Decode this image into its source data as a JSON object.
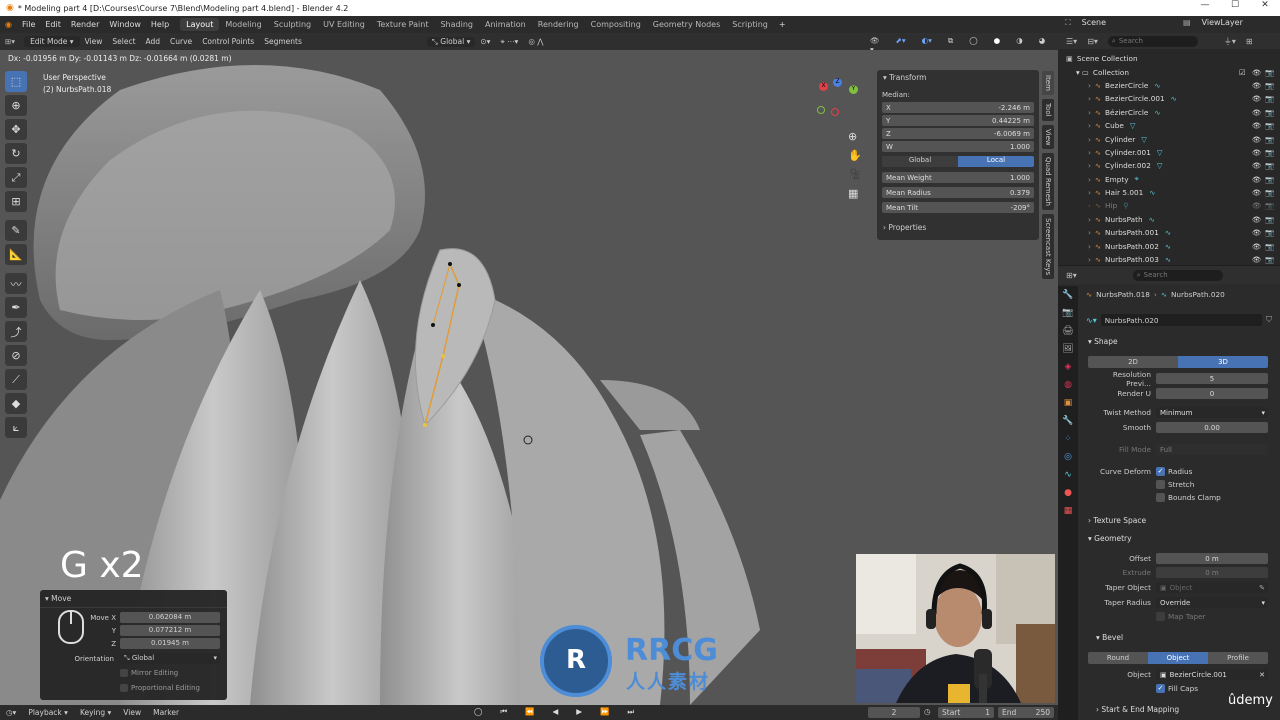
{
  "window": {
    "title": "* Modeling part 4 [D:\\Courses\\Course 7\\Blend\\Modeling part 4.blend] - Blender 4.2",
    "controls": [
      "—",
      "☐",
      "✕"
    ]
  },
  "menubar": {
    "menus": [
      "File",
      "Edit",
      "Render",
      "Window",
      "Help"
    ],
    "workspaces": [
      "Layout",
      "Modeling",
      "Sculpting",
      "UV Editing",
      "Texture Paint",
      "Shading",
      "Animation",
      "Rendering",
      "Compositing",
      "Geometry Nodes",
      "Scripting"
    ],
    "active_workspace": "Layout",
    "add_tab": "+",
    "scene": "Scene",
    "view_layer": "ViewLayer"
  },
  "viewport_header": {
    "mode": "Edit Mode",
    "menus": [
      "View",
      "Select",
      "Add",
      "Curve",
      "Control Points",
      "Segments"
    ],
    "orientation": "Global",
    "status_line": "Dx: -0.01956 m   Dy: -0.01143 m   Dz: -0.01664 m (0.0281 m)"
  },
  "viewport": {
    "view_name": "User Perspective",
    "object_name": "(2) NurbsPath.018",
    "key_overlay": "G x2",
    "gizmo_axes": {
      "x": "X",
      "y": "Y",
      "z": "Z"
    }
  },
  "side_tabs": [
    "Item",
    "Tool",
    "View",
    "Quad Remesh",
    "Screencast Keys"
  ],
  "transform_panel": {
    "title": "Transform",
    "median_label": "Median:",
    "fields": [
      {
        "label": "X",
        "value": "-2.246 m"
      },
      {
        "label": "Y",
        "value": "0.44225 m"
      },
      {
        "label": "Z",
        "value": "-6.0069 m"
      },
      {
        "label": "W",
        "value": "1.000"
      }
    ],
    "space_options": [
      "Global",
      "Local"
    ],
    "active_space": "Local",
    "mean_fields": [
      {
        "label": "Mean Weight",
        "value": "1.000"
      },
      {
        "label": "Mean Radius",
        "value": "0.379"
      },
      {
        "label": "Mean Tilt",
        "value": "-209°"
      }
    ],
    "properties_label": "Properties"
  },
  "outliner": {
    "search_placeholder": "Search",
    "scene_collection": "Scene Collection",
    "collection": "Collection",
    "items": [
      {
        "name": "BezierCircle",
        "dim": false
      },
      {
        "name": "BezierCircle.001",
        "dim": false
      },
      {
        "name": "BézierCircle",
        "dim": false
      },
      {
        "name": "Cube",
        "dim": false
      },
      {
        "name": "Cylinder",
        "dim": false
      },
      {
        "name": "Cylinder.001",
        "dim": false
      },
      {
        "name": "Cylinder.002",
        "dim": false
      },
      {
        "name": "Empty",
        "dim": false
      },
      {
        "name": "Hair 5.001",
        "dim": false
      },
      {
        "name": "Hip",
        "dim": true
      },
      {
        "name": "NurbsPath",
        "dim": false
      },
      {
        "name": "NurbsPath.001",
        "dim": false
      },
      {
        "name": "NurbsPath.002",
        "dim": false
      },
      {
        "name": "NurbsPath.003",
        "dim": false
      }
    ]
  },
  "properties": {
    "search_placeholder": "Search",
    "breadcrumb": [
      "NurbsPath.018",
      "NurbsPath.020"
    ],
    "datablock": "NurbsPath.020",
    "shape": {
      "title": "Shape",
      "dims": [
        "2D",
        "3D"
      ],
      "active_dim": "3D",
      "resolution_preview_label": "Resolution Previ...",
      "resolution_preview": "5",
      "render_u_label": "Render U",
      "render_u": "0",
      "twist_method_label": "Twist Method",
      "twist_method": "Minimum",
      "smooth_label": "Smooth",
      "smooth": "0.00",
      "fill_mode_label": "Fill Mode",
      "fill_mode": "Full",
      "curve_deform_label": "Curve Deform",
      "radius_label": "Radius",
      "stretch_label": "Stretch",
      "bounds_clamp_label": "Bounds Clamp"
    },
    "texture_space": "Texture Space",
    "geometry": {
      "title": "Geometry",
      "offset_label": "Offset",
      "offset": "0 m",
      "extrude_label": "Extrude",
      "extrude": "0 m",
      "taper_object_label": "Taper Object",
      "taper_object_placeholder": "Object",
      "taper_radius_label": "Taper Radius",
      "taper_radius": "Override",
      "map_taper_label": "Map Taper"
    },
    "bevel": {
      "title": "Bevel",
      "modes": [
        "Round",
        "Object",
        "Profile"
      ],
      "active_mode": "Object",
      "object_label": "Object",
      "object_value": "BezierCircle.001",
      "fill_caps_label": "Fill Caps"
    },
    "start_end_mapping": "Start & End Mapping"
  },
  "operator_panel": {
    "title": "Move",
    "move_x_label": "Move X",
    "move_x": "0.062084 m",
    "y_label": "Y",
    "y": "0.077212 m",
    "z_label": "Z",
    "z": "0.01945 m",
    "orientation_label": "Orientation",
    "orientation": "Global",
    "mirror_label": "Mirror Editing",
    "proportional_label": "Proportional Editing"
  },
  "statusbar": {
    "menus": [
      "Playback",
      "Keying",
      "View",
      "Marker"
    ],
    "frame": "2",
    "start_label": "Start",
    "start": "1",
    "end_label": "End",
    "end": "250"
  },
  "watermark": {
    "logo": "RRCG",
    "sub": "人人素材",
    "brand": "ûdemy"
  }
}
